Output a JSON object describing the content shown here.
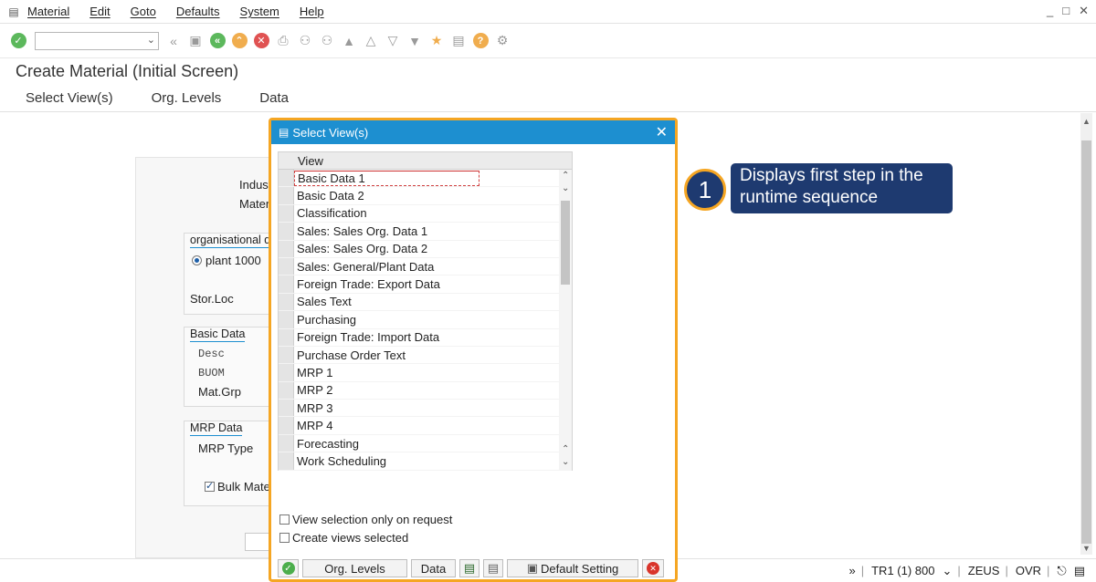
{
  "menu": [
    "Material",
    "Edit",
    "Goto",
    "Defaults",
    "System",
    "Help"
  ],
  "screen": {
    "title": "Create Material (Initial Screen)",
    "app_toolbar": [
      "Select View(s)",
      "Org. Levels",
      "Data"
    ]
  },
  "background": {
    "industry_label": "Indust",
    "material_label": "Mater",
    "org_group_title": "organisational d",
    "plant_option": "plant 1000",
    "stor_loc_label": "Stor.Loc",
    "basic_group_title": "Basic Data",
    "desc_label": "Desc",
    "buom_label": "BUOM",
    "matgrp_label": "Mat.Grp",
    "mrp_group_title": "MRP Data",
    "mrp_type_label": "MRP Type",
    "bulk_label": "Bulk Materi"
  },
  "dialog": {
    "title": "Select View(s)",
    "column_header": "View",
    "views": [
      "Basic Data 1",
      "Basic Data 2",
      "Classification",
      "Sales: Sales Org. Data 1",
      "Sales: Sales Org. Data 2",
      "Sales: General/Plant Data",
      "Foreign Trade: Export Data",
      "Sales Text",
      "Purchasing",
      "Foreign Trade: Import Data",
      "Purchase Order Text",
      "MRP 1",
      "MRP 2",
      "MRP 3",
      "MRP 4",
      "Forecasting",
      "Work Scheduling"
    ],
    "option_request": "View selection only on request",
    "option_create": "Create views selected",
    "buttons": {
      "org_levels": "Org. Levels",
      "data": "Data",
      "default_setting": "Default Setting"
    }
  },
  "callout": {
    "number": "1",
    "text": "Displays first step in the runtime sequence"
  },
  "status": {
    "system": "TR1 (1) 800",
    "server": "ZEUS",
    "mode": "OVR"
  },
  "colors": {
    "dialog_title": "#1d8fd0",
    "highlight_border": "#f5a623",
    "callout_bg": "#1e3a70"
  }
}
